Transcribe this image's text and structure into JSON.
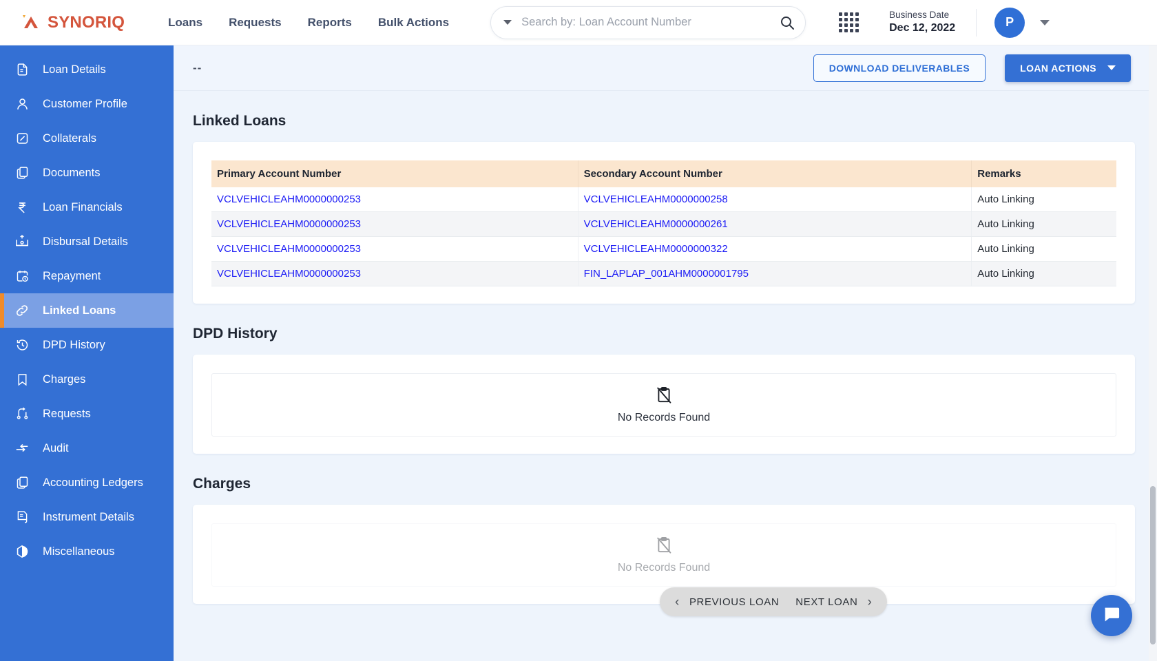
{
  "brand": {
    "name": "SYNORIQ",
    "logo_icon": "synoriq-chevron-logo"
  },
  "topnav": {
    "items": [
      {
        "label": "Loans"
      },
      {
        "label": "Requests"
      },
      {
        "label": "Reports"
      },
      {
        "label": "Bulk Actions"
      }
    ]
  },
  "search": {
    "placeholder": "Search by: Loan Account Number",
    "value": "",
    "dropdown_icon": "chevron-down-icon",
    "submit_icon": "search-icon"
  },
  "apps_icon": "apps-grid-icon",
  "business_date": {
    "label": "Business Date",
    "value": "Dec 12, 2022"
  },
  "user": {
    "initial": "P",
    "menu_icon": "chevron-down-icon"
  },
  "sidebar": {
    "active": "Linked Loans",
    "items": [
      {
        "label": "Loan Details",
        "icon": "document-lines-icon"
      },
      {
        "label": "Customer Profile",
        "icon": "person-icon"
      },
      {
        "label": "Collaterals",
        "icon": "square-slash-icon"
      },
      {
        "label": "Documents",
        "icon": "copy-pages-icon"
      },
      {
        "label": "Loan Financials",
        "icon": "rupee-icon"
      },
      {
        "label": "Disbursal Details",
        "icon": "cash-out-icon"
      },
      {
        "label": "Repayment",
        "icon": "calendar-clock-icon"
      },
      {
        "label": "Linked Loans",
        "icon": "chain-link-icon"
      },
      {
        "label": "DPD History",
        "icon": "history-clock-icon"
      },
      {
        "label": "Charges",
        "icon": "bookmark-icon"
      },
      {
        "label": "Requests",
        "icon": "branch-arrow-icon"
      },
      {
        "label": "Audit",
        "icon": "arrows-exchange-icon"
      },
      {
        "label": "Accounting Ledgers",
        "icon": "copy-pages-icon"
      },
      {
        "label": "Instrument Details",
        "icon": "receipt-lines-icon"
      },
      {
        "label": "Miscellaneous",
        "icon": "hexagon-half-icon"
      }
    ]
  },
  "action_bar": {
    "subtitle": "--",
    "download_label": "DOWNLOAD DELIVERABLES",
    "loan_actions_label": "LOAN ACTIONS",
    "loan_actions_caret": "chevron-down-icon"
  },
  "sections": [
    {
      "title": "Linked Loans",
      "type": "table",
      "columns": [
        "Primary Account Number",
        "Secondary Account Number",
        "Remarks"
      ],
      "rows": [
        [
          "VCLVEHICLEAHM0000000253",
          "VCLVEHICLEAHM0000000258",
          "Auto Linking"
        ],
        [
          "VCLVEHICLEAHM0000000253",
          "VCLVEHICLEAHM0000000261",
          "Auto Linking"
        ],
        [
          "VCLVEHICLEAHM0000000253",
          "VCLVEHICLEAHM0000000322",
          "Auto Linking"
        ],
        [
          "VCLVEHICLEAHM0000000253",
          "FIN_LAPLAP_001AHM0000001795",
          "Auto Linking"
        ]
      ]
    },
    {
      "title": "DPD History",
      "type": "empty",
      "empty_text": "No Records Found",
      "empty_icon": "clipboard-slash-icon"
    },
    {
      "title": "Charges",
      "type": "empty",
      "empty_text": "No Records Found",
      "empty_icon": "clipboard-slash-icon"
    }
  ],
  "pager": {
    "previous_label": "PREVIOUS LOAN",
    "next_label": "NEXT LOAN",
    "prev_icon": "chevron-left-icon",
    "next_icon": "chevron-right-icon"
  },
  "chat_fab": {
    "icon": "chat-bubble-icon"
  },
  "colors": {
    "brand_red": "#d4553c",
    "sidebar_blue": "#3470d4",
    "sidebar_active": "#7ba0e4",
    "active_marker_orange": "#ef8b2a",
    "primary_blue": "#3470d4",
    "link_blue": "#1b1bf5",
    "table_header_cream": "#fbe6cf",
    "page_bg": "#eef4fc"
  }
}
